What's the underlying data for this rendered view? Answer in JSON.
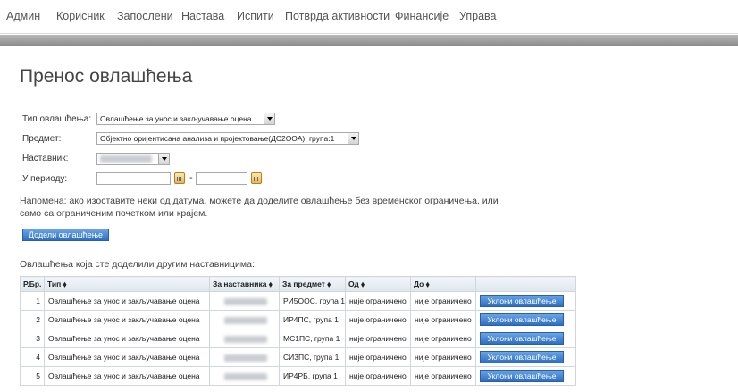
{
  "nav": {
    "items": [
      "Админ",
      "Корисник",
      "Запослени",
      "Настава",
      "Испити",
      "Потврда активности",
      "Финансије",
      "Управа"
    ]
  },
  "page": {
    "title": "Пренос овлашћења"
  },
  "form": {
    "type_label": "Тип овлашћења:",
    "type_value": "Овлашћење за унос и закључавање оцена",
    "subject_label": "Предмет:",
    "subject_value": "Објектно оријентисана анализа и пројектовање(ДС2ООА), група:1",
    "teacher_label": "Наставник:",
    "period_label": "У периоду:",
    "period_from": "",
    "period_to": "",
    "period_separator": "-",
    "note": "Напомена: ако изоставите неки од датума, можете да доделите овлашћење без временског ограничења, или само са ограниченим почетком или крајем.",
    "assign_button": "Додели овлашћење"
  },
  "table": {
    "caption": "Овлашћења која сте доделили другим наставницима:",
    "headers": [
      "Р.Бр.",
      "Тип ⬧",
      "За наставника ⬧",
      "За предмет ⬧",
      "Од ⬧",
      "До ⬧",
      ""
    ],
    "rows": [
      {
        "n": "1",
        "type": "Овлашћење за унос и закључавање оцена",
        "subject": "РИ5ООС, група 1",
        "from": "није ограничено",
        "to": "није ограничено",
        "action": "Уклони овлашћење"
      },
      {
        "n": "2",
        "type": "Овлашћење за унос и закључавање оцена",
        "subject": "ИР4ПС, група 1",
        "from": "није ограничено",
        "to": "није ограничено",
        "action": "Уклони овлашћење"
      },
      {
        "n": "3",
        "type": "Овлашћење за унос и закључавање оцена",
        "subject": "МС1ПС, група 1",
        "from": "није ограничено",
        "to": "није ограничено",
        "action": "Уклони овлашћење"
      },
      {
        "n": "4",
        "type": "Овлашћење за унос и закључавање оцена",
        "subject": "СИ3ПС, група 1",
        "from": "није ограничено",
        "to": "није ограничено",
        "action": "Уклони овлашћење"
      },
      {
        "n": "5",
        "type": "Овлашћење за унос и закључавање оцена",
        "subject": "ИР4РБ, група 1",
        "from": "није ограничено",
        "to": "није ограничено",
        "action": "Уклони овлашћење"
      }
    ]
  },
  "colors": {
    "button_blue": "#2e6fc5",
    "band_gray": "#8c8c8c"
  },
  "icons": {
    "calendar": "calendar-icon",
    "dropdown": "chevron-down-icon"
  }
}
